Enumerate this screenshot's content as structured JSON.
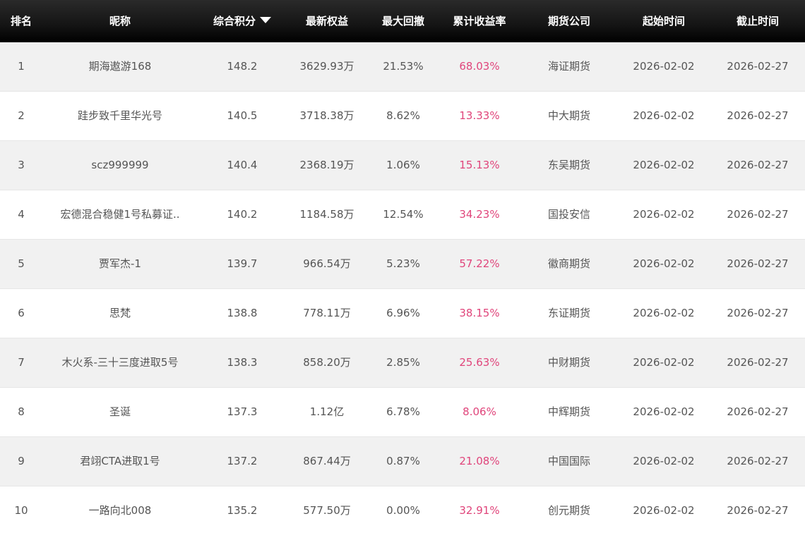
{
  "columns": {
    "rank": "排名",
    "nickname": "昵称",
    "score": "综合积分",
    "equity": "最新权益",
    "max_drawdown": "最大回撤",
    "cumulative_return": "累计收益率",
    "futures_firm": "期货公司",
    "start_time": "起始时间",
    "end_time": "截止时间"
  },
  "sort": {
    "column": "score",
    "direction": "descending",
    "icon": "sort-desc-icon"
  },
  "colors": {
    "header_bg": "#000000",
    "header_text": "#ffffff",
    "row_alt_bg": "#f1f1f1",
    "row_bg": "#ffffff",
    "text": "#555555",
    "return_text": "#e0457b"
  },
  "rows": [
    {
      "rank": "1",
      "nickname": "期海遨游168",
      "score": "148.2",
      "equity": "3629.93万",
      "max_drawdown": "21.53%",
      "cumulative_return": "68.03%",
      "futures_firm": "海证期货",
      "start_time": "2026-02-02",
      "end_time": "2026-02-27"
    },
    {
      "rank": "2",
      "nickname": "跬步致千里华光号",
      "score": "140.5",
      "equity": "3718.38万",
      "max_drawdown": "8.62%",
      "cumulative_return": "13.33%",
      "futures_firm": "中大期货",
      "start_time": "2026-02-02",
      "end_time": "2026-02-27"
    },
    {
      "rank": "3",
      "nickname": "scz999999",
      "score": "140.4",
      "equity": "2368.19万",
      "max_drawdown": "1.06%",
      "cumulative_return": "15.13%",
      "futures_firm": "东吴期货",
      "start_time": "2026-02-02",
      "end_time": "2026-02-27"
    },
    {
      "rank": "4",
      "nickname": "宏德混合稳健1号私募证..",
      "score": "140.2",
      "equity": "1184.58万",
      "max_drawdown": "12.54%",
      "cumulative_return": "34.23%",
      "futures_firm": "国投安信",
      "start_time": "2026-02-02",
      "end_time": "2026-02-27"
    },
    {
      "rank": "5",
      "nickname": "贾军杰-1",
      "score": "139.7",
      "equity": "966.54万",
      "max_drawdown": "5.23%",
      "cumulative_return": "57.22%",
      "futures_firm": "徽商期货",
      "start_time": "2026-02-02",
      "end_time": "2026-02-27"
    },
    {
      "rank": "6",
      "nickname": "思梵",
      "score": "138.8",
      "equity": "778.11万",
      "max_drawdown": "6.96%",
      "cumulative_return": "38.15%",
      "futures_firm": "东证期货",
      "start_time": "2026-02-02",
      "end_time": "2026-02-27"
    },
    {
      "rank": "7",
      "nickname": "木火系-三十三度进取5号",
      "score": "138.3",
      "equity": "858.20万",
      "max_drawdown": "2.85%",
      "cumulative_return": "25.63%",
      "futures_firm": "中财期货",
      "start_time": "2026-02-02",
      "end_time": "2026-02-27"
    },
    {
      "rank": "8",
      "nickname": "圣诞",
      "score": "137.3",
      "equity": "1.12亿",
      "max_drawdown": "6.78%",
      "cumulative_return": "8.06%",
      "futures_firm": "中辉期货",
      "start_time": "2026-02-02",
      "end_time": "2026-02-27"
    },
    {
      "rank": "9",
      "nickname": "君翊CTA进取1号",
      "score": "137.2",
      "equity": "867.44万",
      "max_drawdown": "0.87%",
      "cumulative_return": "21.08%",
      "futures_firm": "中国国际",
      "start_time": "2026-02-02",
      "end_time": "2026-02-27"
    },
    {
      "rank": "10",
      "nickname": "一路向北008",
      "score": "135.2",
      "equity": "577.50万",
      "max_drawdown": "0.00%",
      "cumulative_return": "32.91%",
      "futures_firm": "创元期货",
      "start_time": "2026-02-02",
      "end_time": "2026-02-27"
    }
  ]
}
